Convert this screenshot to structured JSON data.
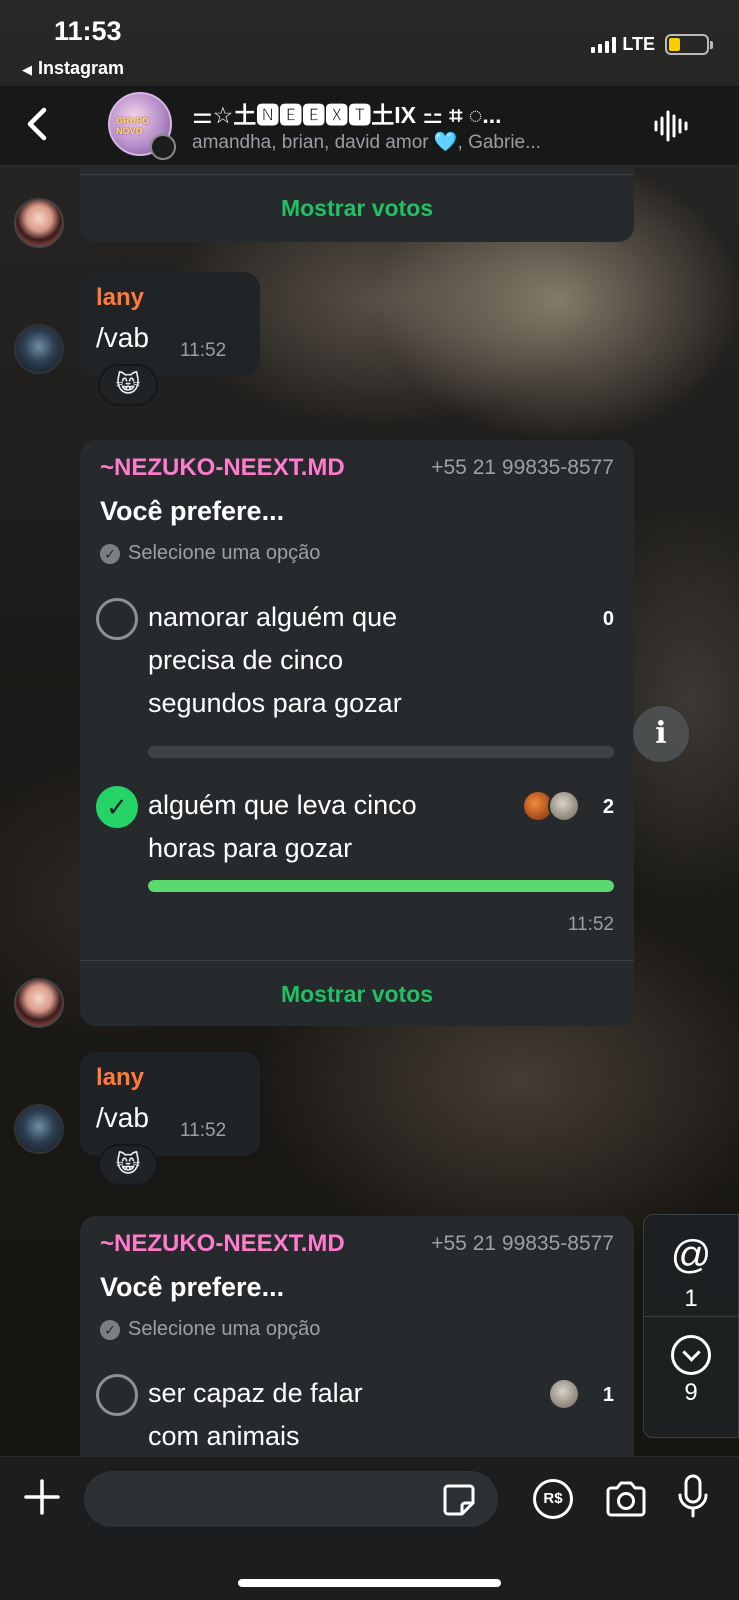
{
  "status_bar": {
    "time": "11:53",
    "back_app": "Instagram",
    "network": "LTE",
    "battery_level": 0.3
  },
  "header": {
    "group_title": "⚌☆⼟🅽🅴🅴🆇🆃⼟IX ⚍ ⌗ ◌...",
    "group_avatar_text": "GRUPO NOVO",
    "members": "amandha, brian, david amor 🩵, Gabrie..."
  },
  "messages": {
    "poll1_show_votes": "Mostrar votos",
    "lany1": {
      "sender": "lany",
      "text": "/vab",
      "time": "11:52",
      "reaction": "😸"
    },
    "poll2": {
      "sender": "~NEZUKO-NEEXT.MD",
      "phone": "+55 21 99835-8577",
      "question": "Você prefere...",
      "hint": "Selecione uma opção",
      "options": [
        {
          "line1": "namorar alguém que",
          "line2": "precisa de cinco",
          "line3": "segundos para gozar",
          "count": "0",
          "fraction": 0
        },
        {
          "line1": "alguém que leva cinco",
          "line2": "horas para gozar",
          "count": "2",
          "fraction": 1
        }
      ],
      "time": "11:52",
      "show_votes": "Mostrar votos"
    },
    "lany2": {
      "sender": "lany",
      "text": "/vab",
      "time": "11:52",
      "reaction": "😸"
    },
    "poll3": {
      "sender": "~NEZUKO-NEEXT.MD",
      "phone": "+55 21 99835-8577",
      "question": "Você prefere...",
      "hint": "Selecione uma opção",
      "options": [
        {
          "line1": "ser capaz de falar",
          "line2": "com animais",
          "count": "1"
        }
      ]
    }
  },
  "side_panel": {
    "mentions_icon": "@",
    "mentions_count": "1",
    "unread_count": "9"
  },
  "input": {
    "placeholder": "",
    "pay_label": "R$"
  },
  "colors": {
    "accent_green": "#21c063",
    "bot_name_pink": "#ff7bcd",
    "lany_orange": "#ff7a3d",
    "bar_green": "#59d96e"
  }
}
